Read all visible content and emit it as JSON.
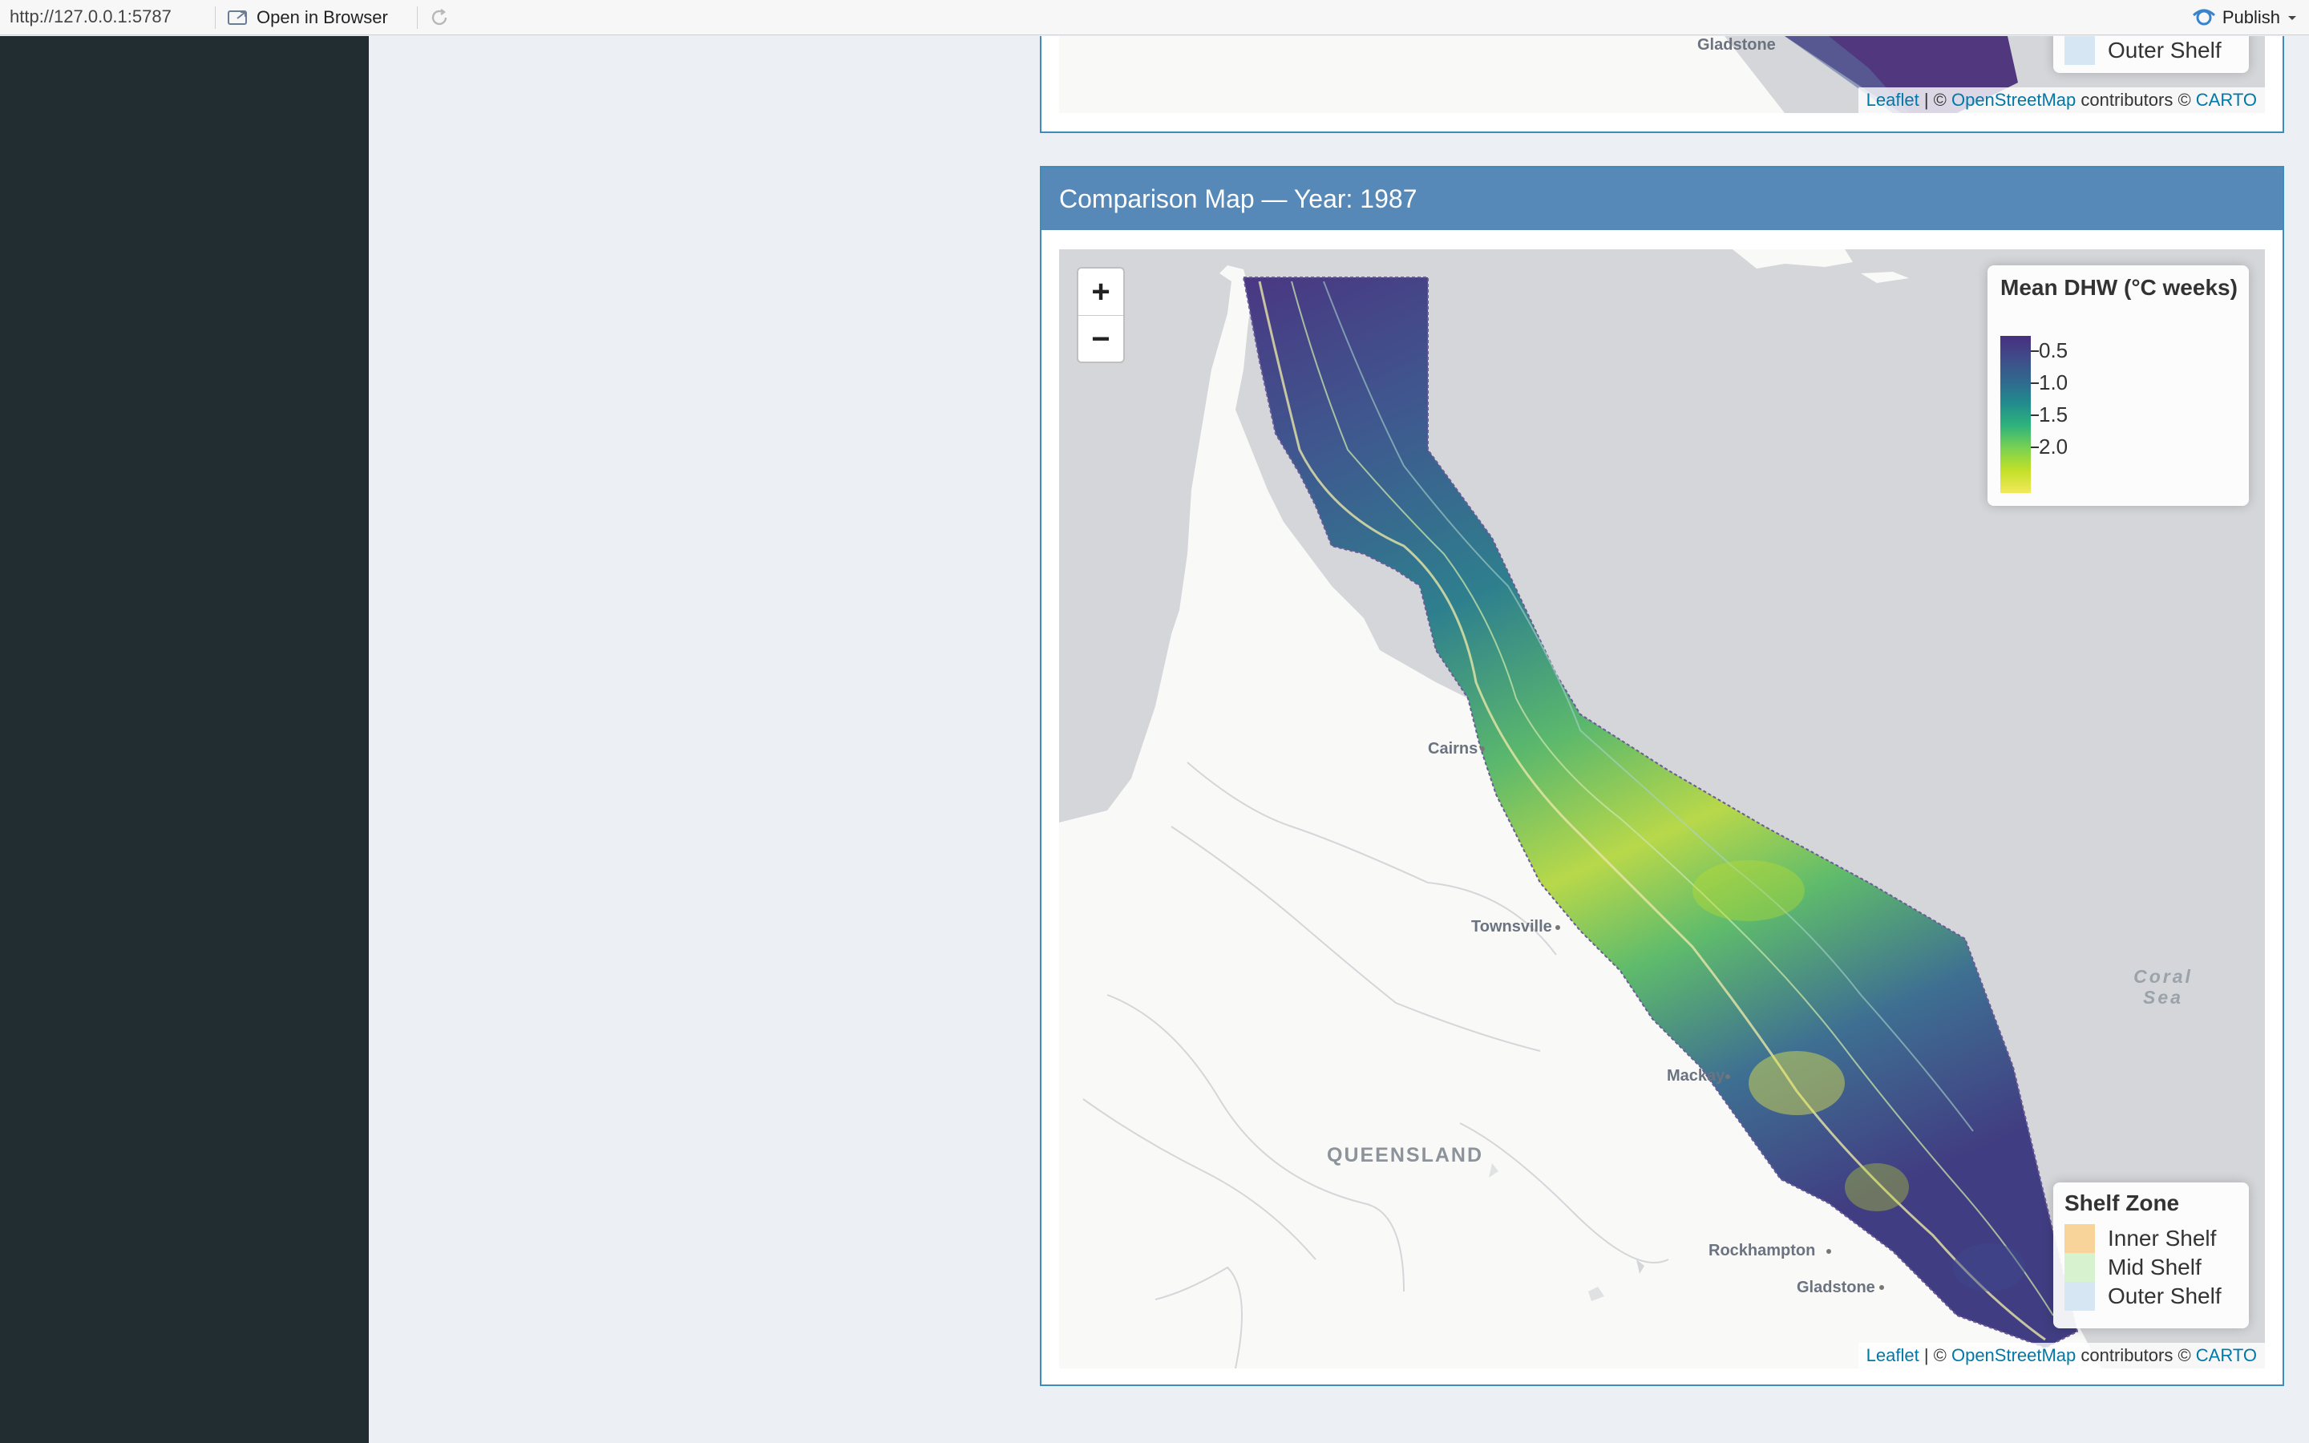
{
  "browser_bar": {
    "url": "http://127.0.0.1:5787",
    "open_in_browser": "Open in Browser",
    "publish": "Publish"
  },
  "top_box": {
    "legend_partial": "Outer Shelf",
    "place_gladstone": "Gladstone",
    "attribution": {
      "leaflet": "Leaflet",
      "sep1": " | © ",
      "osm": "OpenStreetMap",
      "contrib": " contributors © ",
      "carto": "CARTO"
    }
  },
  "comparison": {
    "title": "Comparison Map — Year: 1987",
    "zoom_in": "+",
    "zoom_out": "−",
    "dhw_legend": {
      "title": "Mean DHW (°C weeks)",
      "ticks": [
        "0.5",
        "1.0",
        "1.5",
        "2.0"
      ],
      "colors": [
        "#472f7d",
        "#30688e",
        "#228b8d",
        "#2eb37c",
        "#7ad151",
        "#f2e85a"
      ]
    },
    "shelf_legend": {
      "title": "Shelf Zone",
      "items": [
        {
          "label": "Inner Shelf",
          "color": "#f8d39a"
        },
        {
          "label": "Mid Shelf",
          "color": "#d6f2cf"
        },
        {
          "label": "Outer Shelf",
          "color": "#d6e6f2"
        }
      ]
    },
    "places": {
      "cairns": "Cairns",
      "townsville": "Townsville",
      "mackay": "Mackay",
      "rockhampton": "Rockhampton",
      "gladstone": "Gladstone",
      "queensland": "QUEENSLAND",
      "coral_sea": "Coral\nSea"
    },
    "attribution": {
      "leaflet": "Leaflet",
      "sep1": " | © ",
      "osm": "OpenStreetMap",
      "contrib": " contributors © ",
      "carto": "CARTO"
    }
  }
}
